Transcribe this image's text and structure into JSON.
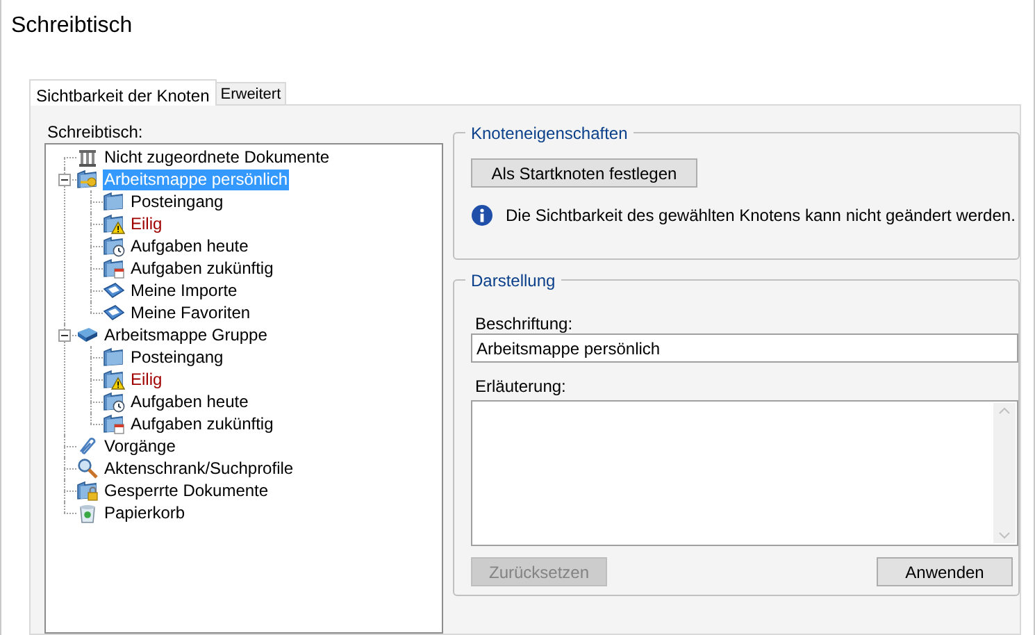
{
  "window": {
    "title": "Schreibtisch"
  },
  "tabs": [
    {
      "label": "Sichtbarkeit der Knoten",
      "selected": true
    },
    {
      "label": "Erweitert",
      "selected": false
    }
  ],
  "tree": {
    "label": "Schreibtisch:",
    "items": [
      {
        "label": "Nicht zugeordnete Dokumente",
        "kind": "archive",
        "selected": false,
        "alert": false
      },
      {
        "label": "Arbeitsmappe persönlich",
        "kind": "keyfolder",
        "selected": true,
        "alert": false,
        "expanded": true,
        "children": [
          {
            "label": "Posteingang",
            "kind": "folder",
            "selected": false,
            "alert": false
          },
          {
            "label": "Eilig",
            "kind": "warning",
            "selected": false,
            "alert": true
          },
          {
            "label": "Aufgaben heute",
            "kind": "clock",
            "selected": false,
            "alert": false
          },
          {
            "label": "Aufgaben zukünftig",
            "kind": "calendar",
            "selected": false,
            "alert": false
          },
          {
            "label": "Meine Importe",
            "kind": "tray",
            "selected": false,
            "alert": false
          },
          {
            "label": "Meine Favoriten",
            "kind": "tray",
            "selected": false,
            "alert": false
          }
        ]
      },
      {
        "label": "Arbeitsmappe Gruppe",
        "kind": "book",
        "selected": false,
        "alert": false,
        "expanded": true,
        "children": [
          {
            "label": "Posteingang",
            "kind": "folder",
            "selected": false,
            "alert": false
          },
          {
            "label": "Eilig",
            "kind": "warning",
            "selected": false,
            "alert": true
          },
          {
            "label": "Aufgaben heute",
            "kind": "clock",
            "selected": false,
            "alert": false
          },
          {
            "label": "Aufgaben zukünftig",
            "kind": "calendar",
            "selected": false,
            "alert": false
          }
        ]
      },
      {
        "label": "Vorgänge",
        "kind": "clip",
        "selected": false,
        "alert": false
      },
      {
        "label": "Aktenschrank/Suchprofile",
        "kind": "search",
        "selected": false,
        "alert": false
      },
      {
        "label": "Gesperrte Dokumente",
        "kind": "lock",
        "selected": false,
        "alert": false
      },
      {
        "label": "Papierkorb",
        "kind": "bin",
        "selected": false,
        "alert": false
      }
    ]
  },
  "node_properties": {
    "title": "Knoteneigenschaften",
    "button": {
      "label": "Als Startknoten festlegen",
      "disabled": false
    },
    "info": "Die Sichtbarkeit des gewählten Knotens kann nicht geändert werden."
  },
  "display": {
    "title": "Darstellung",
    "caption_label": "Beschriftung:",
    "caption_value": "Arbeitsmappe persönlich",
    "note_label": "Erläuterung:",
    "buttons": [
      {
        "label": "Zurücksetzen",
        "disabled": true
      },
      {
        "label": "Anwenden",
        "disabled": false
      }
    ]
  }
}
